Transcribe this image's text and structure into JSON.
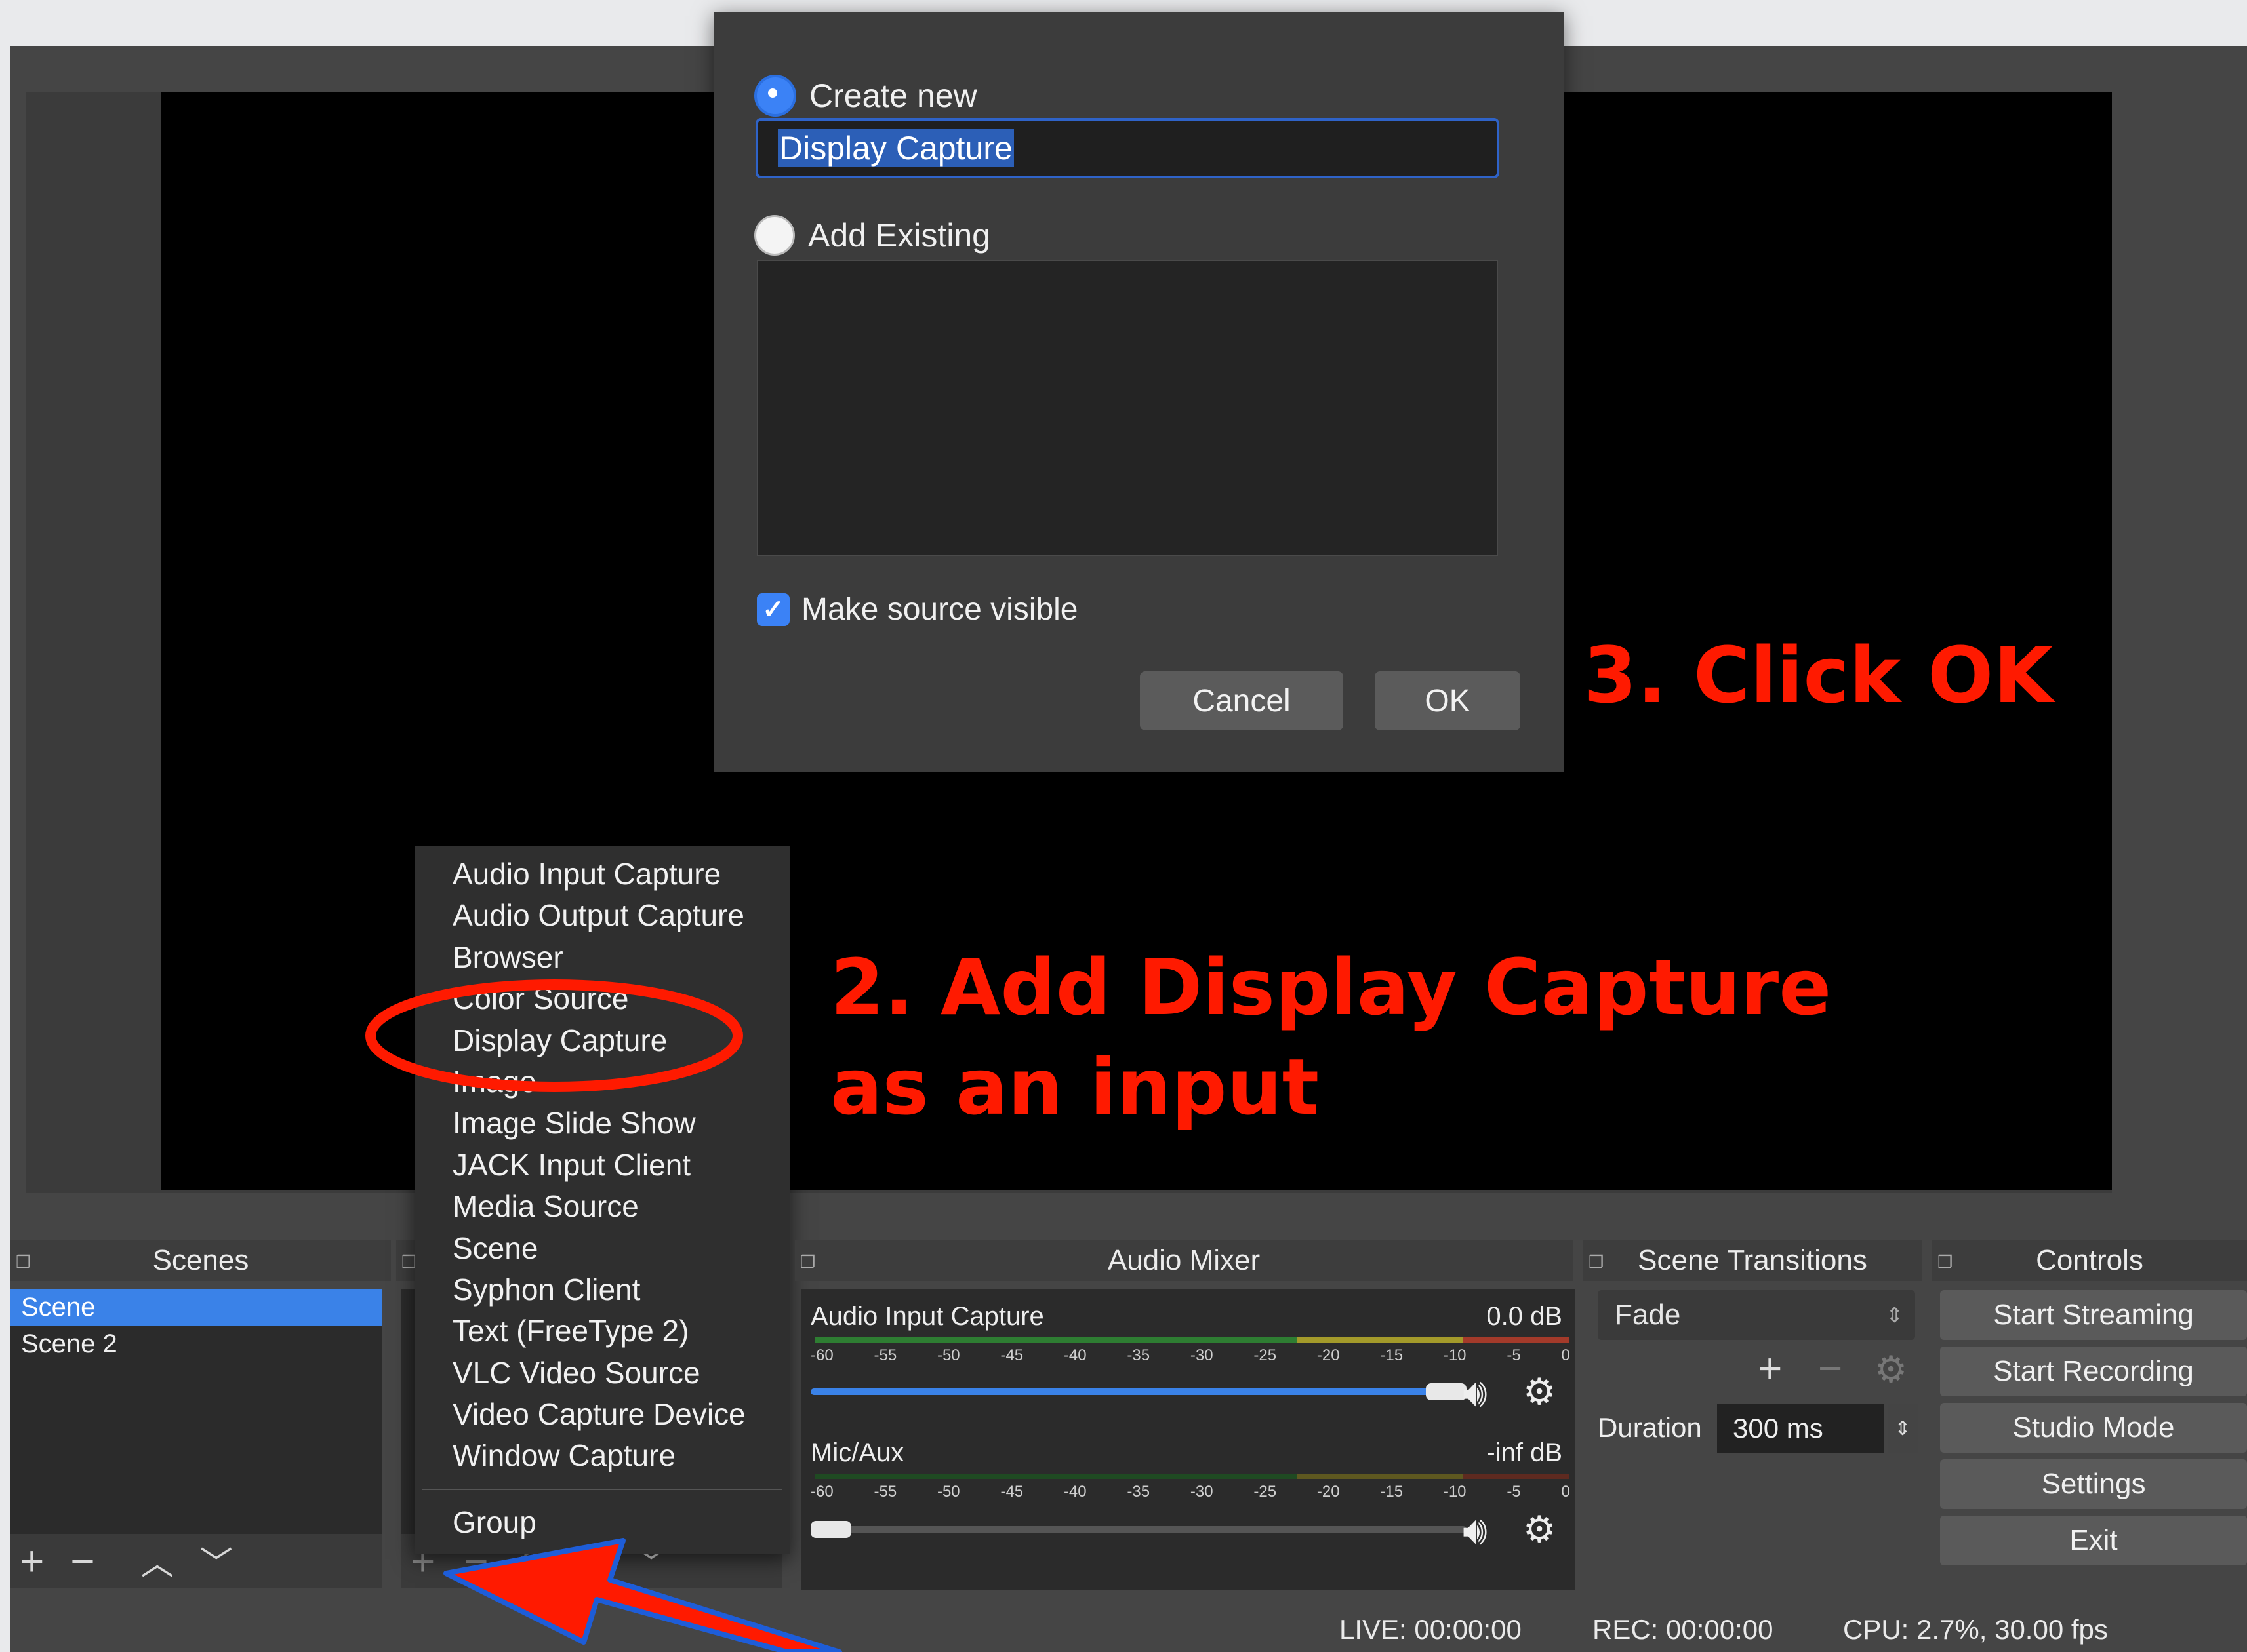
{
  "dialog": {
    "create_new_label": "Create new",
    "name_value": "Display Capture",
    "add_existing_label": "Add Existing",
    "make_visible_label": "Make source visible",
    "cancel_label": "Cancel",
    "ok_label": "OK"
  },
  "annotations": {
    "step3": "3. Click OK",
    "step2_line1": "2. Add Display Capture",
    "step2_line2": "as an input"
  },
  "scenes": {
    "header": "Scenes",
    "items": [
      "Scene",
      "Scene 2"
    ]
  },
  "context_menu": {
    "items": [
      "Audio Input Capture",
      "Audio Output Capture",
      "Browser",
      "Color Source",
      "Display Capture",
      "Image",
      "Image Slide Show",
      "JACK Input Client",
      "Media Source",
      "Scene",
      "Syphon Client",
      "Text (FreeType 2)",
      "VLC Video Source",
      "Video Capture Device",
      "Window Capture"
    ],
    "group_label": "Group"
  },
  "audio_mixer": {
    "header": "Audio Mixer",
    "ticks": [
      "-60",
      "-55",
      "-50",
      "-45",
      "-40",
      "-35",
      "-30",
      "-25",
      "-20",
      "-15",
      "-10",
      "-5",
      "0"
    ],
    "channels": [
      {
        "name": "Audio Input Capture",
        "level": "0.0 dB",
        "volume": 1.0
      },
      {
        "name": "Mic/Aux",
        "level": "-inf dB",
        "volume": 0.0
      }
    ]
  },
  "scene_transitions": {
    "header": "Scene Transitions",
    "transition": "Fade",
    "duration_label": "Duration",
    "duration_value": "300 ms"
  },
  "controls": {
    "header": "Controls",
    "buttons": [
      "Start Streaming",
      "Start Recording",
      "Studio Mode",
      "Settings",
      "Exit"
    ]
  },
  "status_bar": {
    "live": "LIVE: 00:00:00",
    "rec": "REC: 00:00:00",
    "cpu": "CPU: 2.7%, 30.00 fps"
  },
  "colors": {
    "annotation_red": "#ff1a00",
    "accent_blue": "#3a82e8"
  }
}
